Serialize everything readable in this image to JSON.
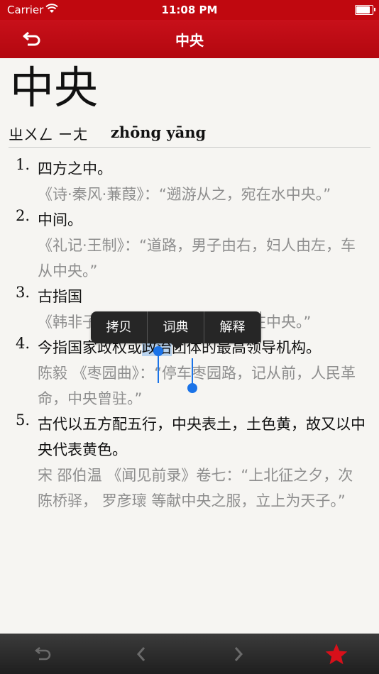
{
  "status_bar": {
    "carrier": "Carrier",
    "time": "11:08 PM",
    "battery_level": 0.95
  },
  "nav": {
    "title": "中央"
  },
  "entry": {
    "headword": "中央",
    "zhuyin": "ㄓㄨㄥ ㄧㄤ",
    "pinyin": "zhōng yāng"
  },
  "definitions": [
    {
      "num": "1.",
      "text": "四方之中。",
      "example": "《诗·秦风·蒹葭》：“遡游从之，宛在水中央。”"
    },
    {
      "num": "2.",
      "text": "中间。",
      "example": "《礼记·王制》：“道路，男子由右，妇人由左，车从中央。”"
    },
    {
      "num": "3.",
      "text": "古指国",
      "example": "《韩非子·扬权》：“事在四方，要在中央。”"
    },
    {
      "num": "4.",
      "text_before": "今指国家政权或",
      "text_selected": "政治",
      "text_after": "团体的最高领导机构。",
      "example": "陈毅 《枣园曲》：“停车枣园路，记从前，人民革命，中央曾驻。”"
    },
    {
      "num": "5.",
      "text": "古代以五方配五行，中央表土，土色黄，故又以中央代表黄色。",
      "example": "宋 邵伯温 《闻见前录》卷七：“上北征之夕，次 陈桥驿， 罗彦瓌 等献中央之服，立上为天子。”"
    }
  ],
  "context_menu": {
    "items": [
      "拷贝",
      "词典",
      "解释"
    ]
  },
  "toolbar": {
    "icons": [
      "back-icon",
      "previous-icon",
      "next-icon",
      "favorite-star-icon"
    ]
  },
  "colors": {
    "brand_red": "#c0080f",
    "selection": "#b9d3ee",
    "handle": "#1a73e8",
    "star": "#d8101a"
  }
}
